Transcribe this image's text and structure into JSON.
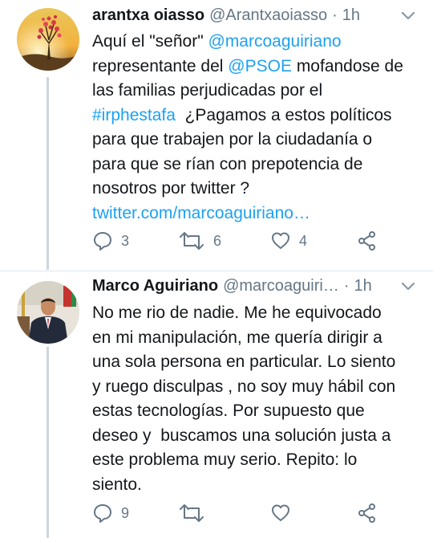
{
  "tweets": [
    {
      "author_name": "arantxa oiasso",
      "author_handle": "@Arantxaoiasso",
      "separator": "·",
      "time": "1h",
      "lines": [
        [
          {
            "t": "Aquí el \"señor\" ",
            "link": false
          },
          {
            "t": "@marcoaguiriano",
            "link": true
          }
        ],
        [
          {
            "t": "representante del ",
            "link": false
          },
          {
            "t": "@PSOE",
            "link": true
          },
          {
            "t": " mofandose de",
            "link": false
          }
        ],
        [
          {
            "t": "las familias perjudicadas por el",
            "link": false
          }
        ],
        [
          {
            "t": "#irphestafa",
            "link": true
          },
          {
            "t": "  ¿Pagamos a estos políticos",
            "link": false
          }
        ],
        [
          {
            "t": "para que trabajen por la ciudadanía o",
            "link": false
          }
        ],
        [
          {
            "t": "para que se rían con prepotencia de",
            "link": false
          }
        ],
        [
          {
            "t": "nosotros por twitter ?",
            "link": false
          }
        ],
        [
          {
            "t": "twitter.com/marcoaguiriano…",
            "link": true
          }
        ]
      ],
      "replies": "3",
      "retweets": "6",
      "likes": "4",
      "icons": [
        "reply-icon",
        "retweet-icon",
        "like-icon",
        "share-icon"
      ]
    },
    {
      "author_name": "Marco Aguiriano",
      "author_handle": "@marcoaguiri…",
      "separator": "·",
      "time": "1h",
      "lines": [
        [
          {
            "t": "No me rio de nadie. Me he equivocado",
            "link": false
          }
        ],
        [
          {
            "t": "en mi manipulación, me quería dirigir a",
            "link": false
          }
        ],
        [
          {
            "t": "una sola persona en particular. Lo siento",
            "link": false
          }
        ],
        [
          {
            "t": "y ruego disculpas , no soy muy hábil con",
            "link": false
          }
        ],
        [
          {
            "t": "estas tecnologías. Por supuesto que",
            "link": false
          }
        ],
        [
          {
            "t": "deseo y  buscamos una solución justa a",
            "link": false
          }
        ],
        [
          {
            "t": "este problema muy serio. Repito: lo",
            "link": false
          }
        ],
        [
          {
            "t": "siento.",
            "link": false
          }
        ]
      ],
      "replies": "9",
      "retweets": "",
      "likes": "",
      "icons": [
        "reply-icon",
        "retweet-icon",
        "like-icon",
        "share-icon"
      ]
    }
  ],
  "colors": {
    "link": "#1da1f2",
    "secondary": "#657786",
    "text": "#14171a",
    "thread_line": "#ccd6dd"
  }
}
